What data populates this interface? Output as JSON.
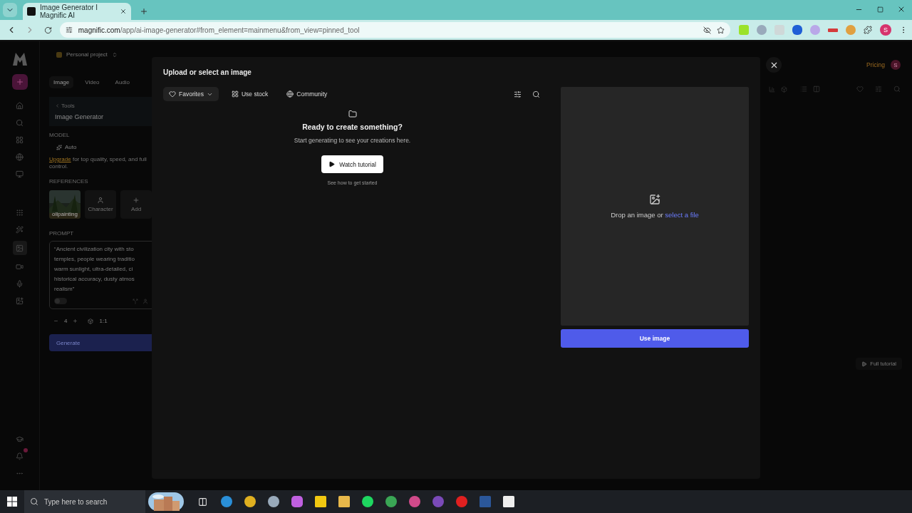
{
  "browser": {
    "tab_title": "Image Generator I Magnific AI",
    "url_domain": "magnific.com",
    "url_path": "/app/ai-image-generator#from_element=mainmenu&from_view=pinned_tool",
    "profile": "S"
  },
  "panel": {
    "project": "Personal project",
    "tabs": [
      {
        "label": "Image",
        "selected": true
      },
      {
        "label": "Video",
        "selected": false
      },
      {
        "label": "Audio",
        "selected": false
      }
    ],
    "breadcrumb": "Tools",
    "title": "Image Generator",
    "model_label": "MODEL",
    "model": "Auto",
    "upgrade_link": "Upgrade",
    "upgrade_text": " for top quality, speed, and full control.",
    "references_label": "REFERENCES",
    "references": [
      {
        "label": "oilpainting",
        "kind": "picture"
      },
      {
        "label": "Character",
        "kind": "character"
      },
      {
        "label": "Add",
        "kind": "add"
      }
    ],
    "prompt_label": "PROMPT",
    "prompt_lines": [
      "“Ancient civilization city with sto",
      "temples, people wearing traditio",
      "warm sunlight, ultra-detailed, ci",
      "historical accuracy, dusty atmos",
      "realism”"
    ],
    "toggle": {
      "on": false
    },
    "count": "4",
    "ratio": "1:1",
    "generate": "Generate"
  },
  "header": {
    "pricing": "Pricing",
    "avatar": "S",
    "full_tutorial": "Full tutorial"
  },
  "modal": {
    "title": "Upload or select an image",
    "filters": [
      {
        "label": "Favorites",
        "kind": "favorites",
        "selected": true
      },
      {
        "label": "Use stock",
        "kind": "stock",
        "selected": false
      },
      {
        "label": "Community",
        "kind": "community",
        "selected": false
      }
    ],
    "empty_heading": "Ready to create something?",
    "empty_text": "Start generating to see your creations here.",
    "tutorial_button": "Watch tutorial",
    "tutorial_hint": "See how to get started",
    "drop_text": "Drop an image or ",
    "drop_link": "select a file",
    "use_button": "Use image"
  },
  "taskbar": {
    "search_placeholder": "Type here to search"
  }
}
